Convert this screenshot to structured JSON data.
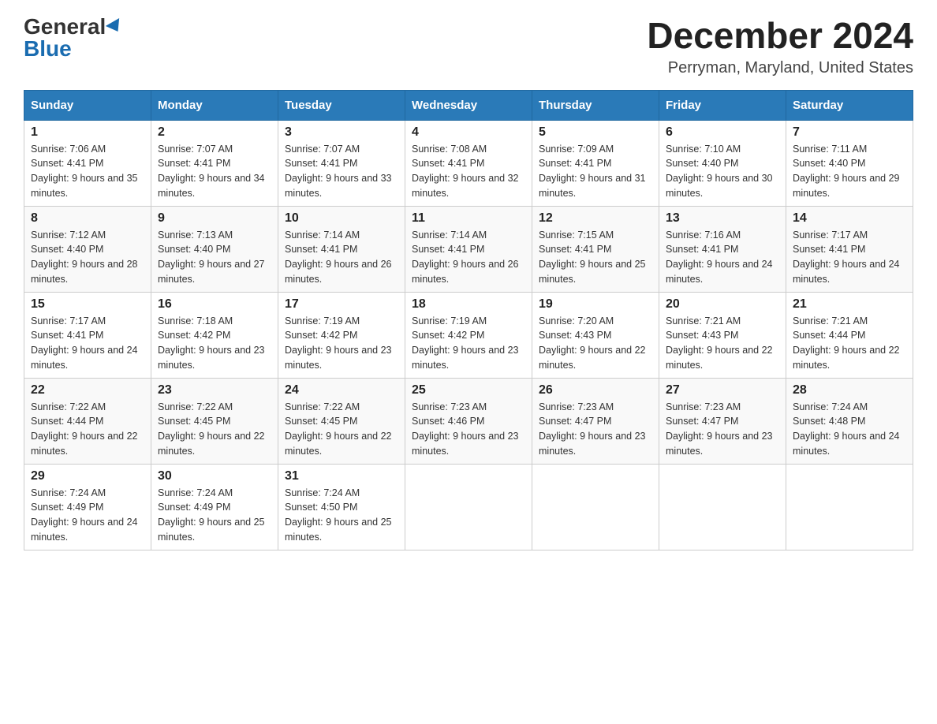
{
  "logo": {
    "general": "General",
    "blue": "Blue"
  },
  "title": "December 2024",
  "location": "Perryman, Maryland, United States",
  "weekdays": [
    "Sunday",
    "Monday",
    "Tuesday",
    "Wednesday",
    "Thursday",
    "Friday",
    "Saturday"
  ],
  "weeks": [
    [
      {
        "day": "1",
        "sunrise": "7:06 AM",
        "sunset": "4:41 PM",
        "daylight": "9 hours and 35 minutes."
      },
      {
        "day": "2",
        "sunrise": "7:07 AM",
        "sunset": "4:41 PM",
        "daylight": "9 hours and 34 minutes."
      },
      {
        "day": "3",
        "sunrise": "7:07 AM",
        "sunset": "4:41 PM",
        "daylight": "9 hours and 33 minutes."
      },
      {
        "day": "4",
        "sunrise": "7:08 AM",
        "sunset": "4:41 PM",
        "daylight": "9 hours and 32 minutes."
      },
      {
        "day": "5",
        "sunrise": "7:09 AM",
        "sunset": "4:41 PM",
        "daylight": "9 hours and 31 minutes."
      },
      {
        "day": "6",
        "sunrise": "7:10 AM",
        "sunset": "4:40 PM",
        "daylight": "9 hours and 30 minutes."
      },
      {
        "day": "7",
        "sunrise": "7:11 AM",
        "sunset": "4:40 PM",
        "daylight": "9 hours and 29 minutes."
      }
    ],
    [
      {
        "day": "8",
        "sunrise": "7:12 AM",
        "sunset": "4:40 PM",
        "daylight": "9 hours and 28 minutes."
      },
      {
        "day": "9",
        "sunrise": "7:13 AM",
        "sunset": "4:40 PM",
        "daylight": "9 hours and 27 minutes."
      },
      {
        "day": "10",
        "sunrise": "7:14 AM",
        "sunset": "4:41 PM",
        "daylight": "9 hours and 26 minutes."
      },
      {
        "day": "11",
        "sunrise": "7:14 AM",
        "sunset": "4:41 PM",
        "daylight": "9 hours and 26 minutes."
      },
      {
        "day": "12",
        "sunrise": "7:15 AM",
        "sunset": "4:41 PM",
        "daylight": "9 hours and 25 minutes."
      },
      {
        "day": "13",
        "sunrise": "7:16 AM",
        "sunset": "4:41 PM",
        "daylight": "9 hours and 24 minutes."
      },
      {
        "day": "14",
        "sunrise": "7:17 AM",
        "sunset": "4:41 PM",
        "daylight": "9 hours and 24 minutes."
      }
    ],
    [
      {
        "day": "15",
        "sunrise": "7:17 AM",
        "sunset": "4:41 PM",
        "daylight": "9 hours and 24 minutes."
      },
      {
        "day": "16",
        "sunrise": "7:18 AM",
        "sunset": "4:42 PM",
        "daylight": "9 hours and 23 minutes."
      },
      {
        "day": "17",
        "sunrise": "7:19 AM",
        "sunset": "4:42 PM",
        "daylight": "9 hours and 23 minutes."
      },
      {
        "day": "18",
        "sunrise": "7:19 AM",
        "sunset": "4:42 PM",
        "daylight": "9 hours and 23 minutes."
      },
      {
        "day": "19",
        "sunrise": "7:20 AM",
        "sunset": "4:43 PM",
        "daylight": "9 hours and 22 minutes."
      },
      {
        "day": "20",
        "sunrise": "7:21 AM",
        "sunset": "4:43 PM",
        "daylight": "9 hours and 22 minutes."
      },
      {
        "day": "21",
        "sunrise": "7:21 AM",
        "sunset": "4:44 PM",
        "daylight": "9 hours and 22 minutes."
      }
    ],
    [
      {
        "day": "22",
        "sunrise": "7:22 AM",
        "sunset": "4:44 PM",
        "daylight": "9 hours and 22 minutes."
      },
      {
        "day": "23",
        "sunrise": "7:22 AM",
        "sunset": "4:45 PM",
        "daylight": "9 hours and 22 minutes."
      },
      {
        "day": "24",
        "sunrise": "7:22 AM",
        "sunset": "4:45 PM",
        "daylight": "9 hours and 22 minutes."
      },
      {
        "day": "25",
        "sunrise": "7:23 AM",
        "sunset": "4:46 PM",
        "daylight": "9 hours and 23 minutes."
      },
      {
        "day": "26",
        "sunrise": "7:23 AM",
        "sunset": "4:47 PM",
        "daylight": "9 hours and 23 minutes."
      },
      {
        "day": "27",
        "sunrise": "7:23 AM",
        "sunset": "4:47 PM",
        "daylight": "9 hours and 23 minutes."
      },
      {
        "day": "28",
        "sunrise": "7:24 AM",
        "sunset": "4:48 PM",
        "daylight": "9 hours and 24 minutes."
      }
    ],
    [
      {
        "day": "29",
        "sunrise": "7:24 AM",
        "sunset": "4:49 PM",
        "daylight": "9 hours and 24 minutes."
      },
      {
        "day": "30",
        "sunrise": "7:24 AM",
        "sunset": "4:49 PM",
        "daylight": "9 hours and 25 minutes."
      },
      {
        "day": "31",
        "sunrise": "7:24 AM",
        "sunset": "4:50 PM",
        "daylight": "9 hours and 25 minutes."
      },
      null,
      null,
      null,
      null
    ]
  ]
}
